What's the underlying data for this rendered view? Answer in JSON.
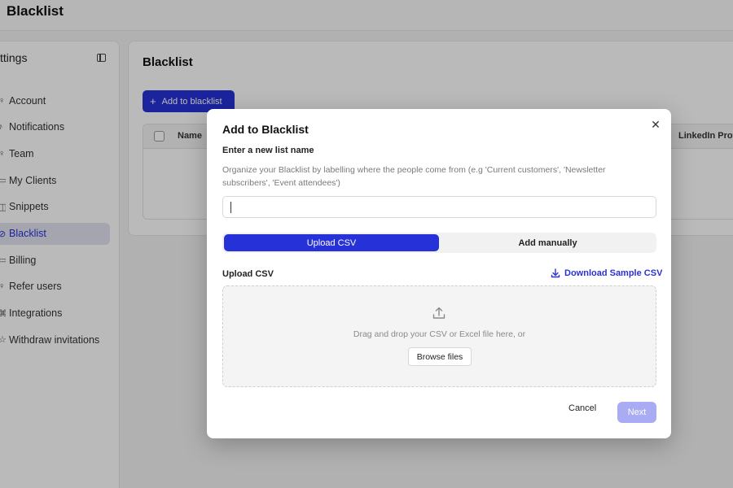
{
  "app": {
    "title": "Blacklist"
  },
  "sidebar": {
    "title": "ttings",
    "items": [
      {
        "icon": "user-icon",
        "glyph": "♀",
        "label": "Account"
      },
      {
        "icon": "bell-icon",
        "glyph": "♪",
        "label": "Notifications"
      },
      {
        "icon": "team-icon",
        "glyph": "♀",
        "label": "Team"
      },
      {
        "icon": "briefcase-icon",
        "glyph": "▭",
        "label": "My Clients"
      },
      {
        "icon": "snippet-icon",
        "glyph": "◫",
        "label": "Snippets"
      },
      {
        "icon": "blacklist-icon",
        "glyph": "⊘",
        "label": "Blacklist",
        "active": true
      },
      {
        "icon": "card-icon",
        "glyph": "▭",
        "label": "Billing"
      },
      {
        "icon": "refer-icon",
        "glyph": "♀",
        "label": "Refer users"
      },
      {
        "icon": "plug-icon",
        "glyph": "⌘",
        "label": "Integrations"
      },
      {
        "icon": "withdraw-icon",
        "glyph": "☆",
        "label": "Withdraw invitations"
      }
    ]
  },
  "main": {
    "title": "Blacklist",
    "add_button": "Add to blacklist",
    "table": {
      "columns": [
        "Name",
        "LinkedIn Profil"
      ]
    }
  },
  "modal": {
    "title": "Add to Blacklist",
    "name_label": "Enter a new list name",
    "name_help": "Organize your Blacklist by labelling where the people come from (e.g 'Current customers', 'Newsletter subscribers', 'Event attendees')",
    "name_value": "",
    "tabs": {
      "upload": "Upload CSV",
      "manual": "Add manually",
      "selected": "upload"
    },
    "upload_label": "Upload CSV",
    "download_link": "Download Sample CSV",
    "drop_text": "Drag and drop your CSV or Excel file here, or",
    "browse_button": "Browse files",
    "cancel_button": "Cancel",
    "next_button": "Next"
  },
  "colors": {
    "accent": "#2632d8",
    "next_disabled": "#a9acf2"
  }
}
